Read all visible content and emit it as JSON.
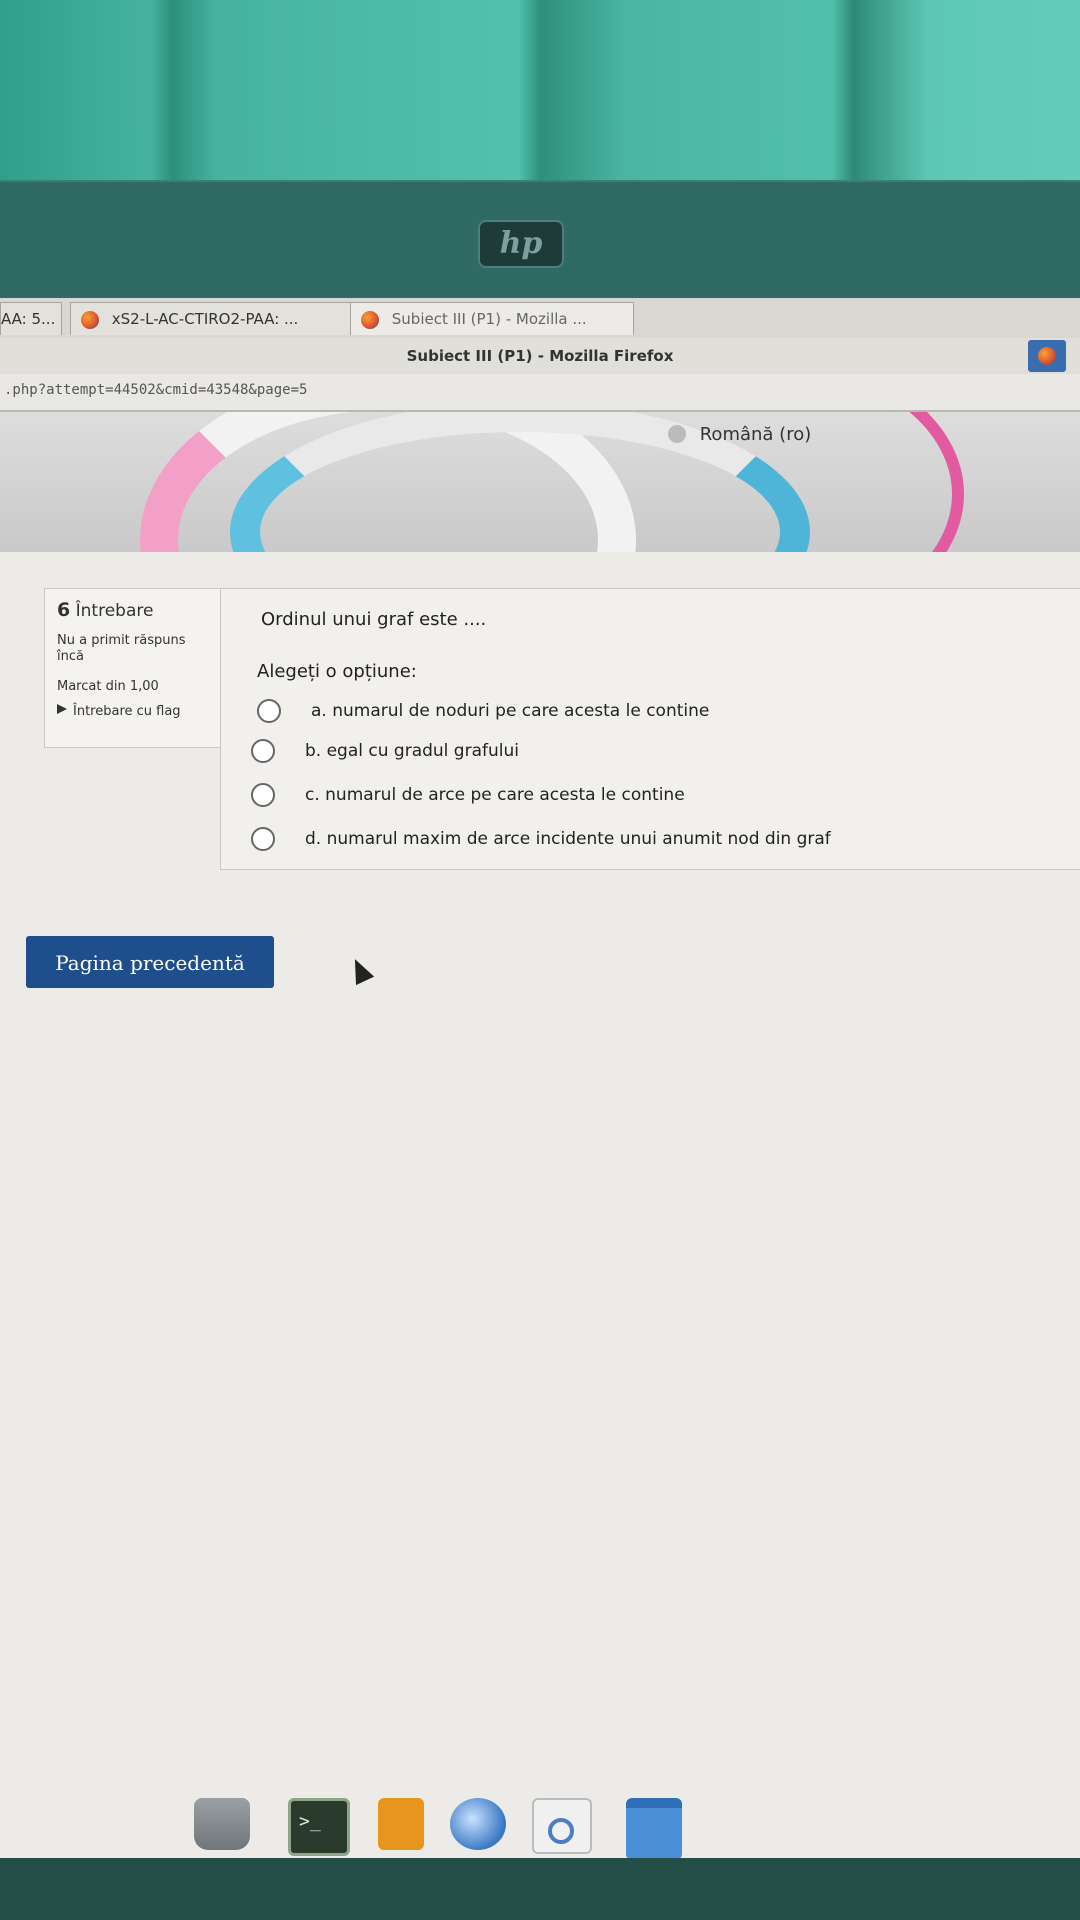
{
  "browser": {
    "tabs": [
      {
        "label": "AA: 5..."
      },
      {
        "label": "xS2-L-AC-CTIRO2-PAA: ..."
      },
      {
        "label": "Subiect III (P1) - Mozilla ..."
      }
    ],
    "window_title": "Subiect III (P1) - Mozilla Firefox",
    "url": ".php?attempt=44502&cmid=43548&page=5"
  },
  "device": {
    "brand_logo": "hp"
  },
  "header": {
    "language": "Română (ro)"
  },
  "question_info": {
    "number": "6",
    "label": "Întrebare",
    "state": "Nu a primit răspuns încă",
    "mark": "Marcat din 1,00",
    "flag_label": "Întrebare cu flag"
  },
  "question": {
    "text": "Ordinul unui graf este ....",
    "prompt": "Alegeți o opțiune:",
    "options": [
      {
        "label": "a. numarul de noduri pe care acesta le contine"
      },
      {
        "label": "b. egal cu gradul grafului"
      },
      {
        "label": "c. numarul de arce pe care acesta le contine"
      },
      {
        "label": "d. numarul maxim de arce incidente unui anumit nod din graf"
      }
    ]
  },
  "navigation": {
    "prev_label": "Pagina precedentă"
  },
  "taskbar": {
    "terminal_glyph": ">_",
    "icons": [
      "drive-icon",
      "terminal-icon",
      "archive-icon",
      "globe-icon",
      "search-icon",
      "folder-icon"
    ]
  },
  "colors": {
    "accent": "#1f4e8c",
    "page_bg": "#ecebe7",
    "bezel": "#2f6b64"
  }
}
